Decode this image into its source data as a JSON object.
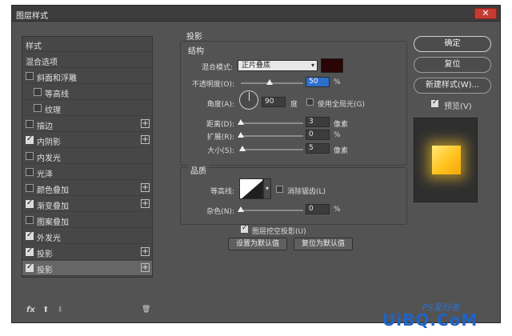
{
  "window": {
    "title": "图层样式",
    "close_glyph": "✕"
  },
  "styles_list": {
    "items": [
      {
        "label": "样式",
        "checkbox": false,
        "checked": false,
        "plus": false,
        "indent": 0,
        "selected": false
      },
      {
        "label": "混合选项",
        "checkbox": false,
        "checked": false,
        "plus": false,
        "indent": 0,
        "selected": false
      },
      {
        "label": "斜面和浮雕",
        "checkbox": true,
        "checked": false,
        "plus": false,
        "indent": 0,
        "selected": false
      },
      {
        "label": "等高线",
        "checkbox": true,
        "checked": false,
        "plus": false,
        "indent": 1,
        "selected": false
      },
      {
        "label": "纹理",
        "checkbox": true,
        "checked": false,
        "plus": false,
        "indent": 1,
        "selected": false
      },
      {
        "label": "描边",
        "checkbox": true,
        "checked": false,
        "plus": true,
        "indent": 0,
        "selected": false
      },
      {
        "label": "内阴影",
        "checkbox": true,
        "checked": true,
        "plus": true,
        "indent": 0,
        "selected": false
      },
      {
        "label": "内发光",
        "checkbox": true,
        "checked": false,
        "plus": false,
        "indent": 0,
        "selected": false
      },
      {
        "label": "光泽",
        "checkbox": true,
        "checked": false,
        "plus": false,
        "indent": 0,
        "selected": false
      },
      {
        "label": "颜色叠加",
        "checkbox": true,
        "checked": false,
        "plus": true,
        "indent": 0,
        "selected": false
      },
      {
        "label": "渐变叠加",
        "checkbox": true,
        "checked": true,
        "plus": true,
        "indent": 0,
        "selected": false
      },
      {
        "label": "图案叠加",
        "checkbox": true,
        "checked": false,
        "plus": false,
        "indent": 0,
        "selected": false
      },
      {
        "label": "外发光",
        "checkbox": true,
        "checked": true,
        "plus": false,
        "indent": 0,
        "selected": false
      },
      {
        "label": "投影",
        "checkbox": true,
        "checked": true,
        "plus": true,
        "indent": 0,
        "selected": false
      },
      {
        "label": "投影",
        "checkbox": true,
        "checked": true,
        "plus": true,
        "indent": 0,
        "selected": true
      }
    ],
    "footer": {
      "fx": "fx",
      "up": "⬆",
      "down": "⬇",
      "trash": "🗑"
    }
  },
  "panel": {
    "heading": "投影",
    "structure": {
      "heading": "结构",
      "blend_mode_label": "混合模式:",
      "blend_mode_value": "正片叠底",
      "shadow_color": "#2a0505",
      "opacity_label": "不透明度(O):",
      "opacity_value": "50",
      "opacity_unit": "%",
      "angle_label": "角度(A):",
      "angle_value": "90",
      "angle_unit": "度",
      "global_light_label": "使用全局光(G)",
      "global_light_checked": false,
      "distance_label": "距离(D):",
      "distance_value": "3",
      "distance_unit": "像素",
      "spread_label": "扩展(R):",
      "spread_value": "0",
      "spread_unit": "%",
      "size_label": "大小(S):",
      "size_value": "5",
      "size_unit": "像素"
    },
    "quality": {
      "heading": "品质",
      "contour_label": "等高线:",
      "antialias_label": "消除锯齿(L)",
      "antialias_checked": false,
      "noise_label": "杂色(N):",
      "noise_value": "0",
      "noise_unit": "%"
    },
    "knockout_label": "图层挖空投影(U)",
    "knockout_checked": true,
    "make_default": "设置为默认值",
    "reset_default": "复位为默认值"
  },
  "actions": {
    "ok": "确定",
    "reset": "复位",
    "new_style": "新建样式(W)...",
    "preview_label": "预览(V)",
    "preview_checked": true
  },
  "watermark": {
    "main": "UiBQ.CoM",
    "small": "PS爱好者"
  }
}
